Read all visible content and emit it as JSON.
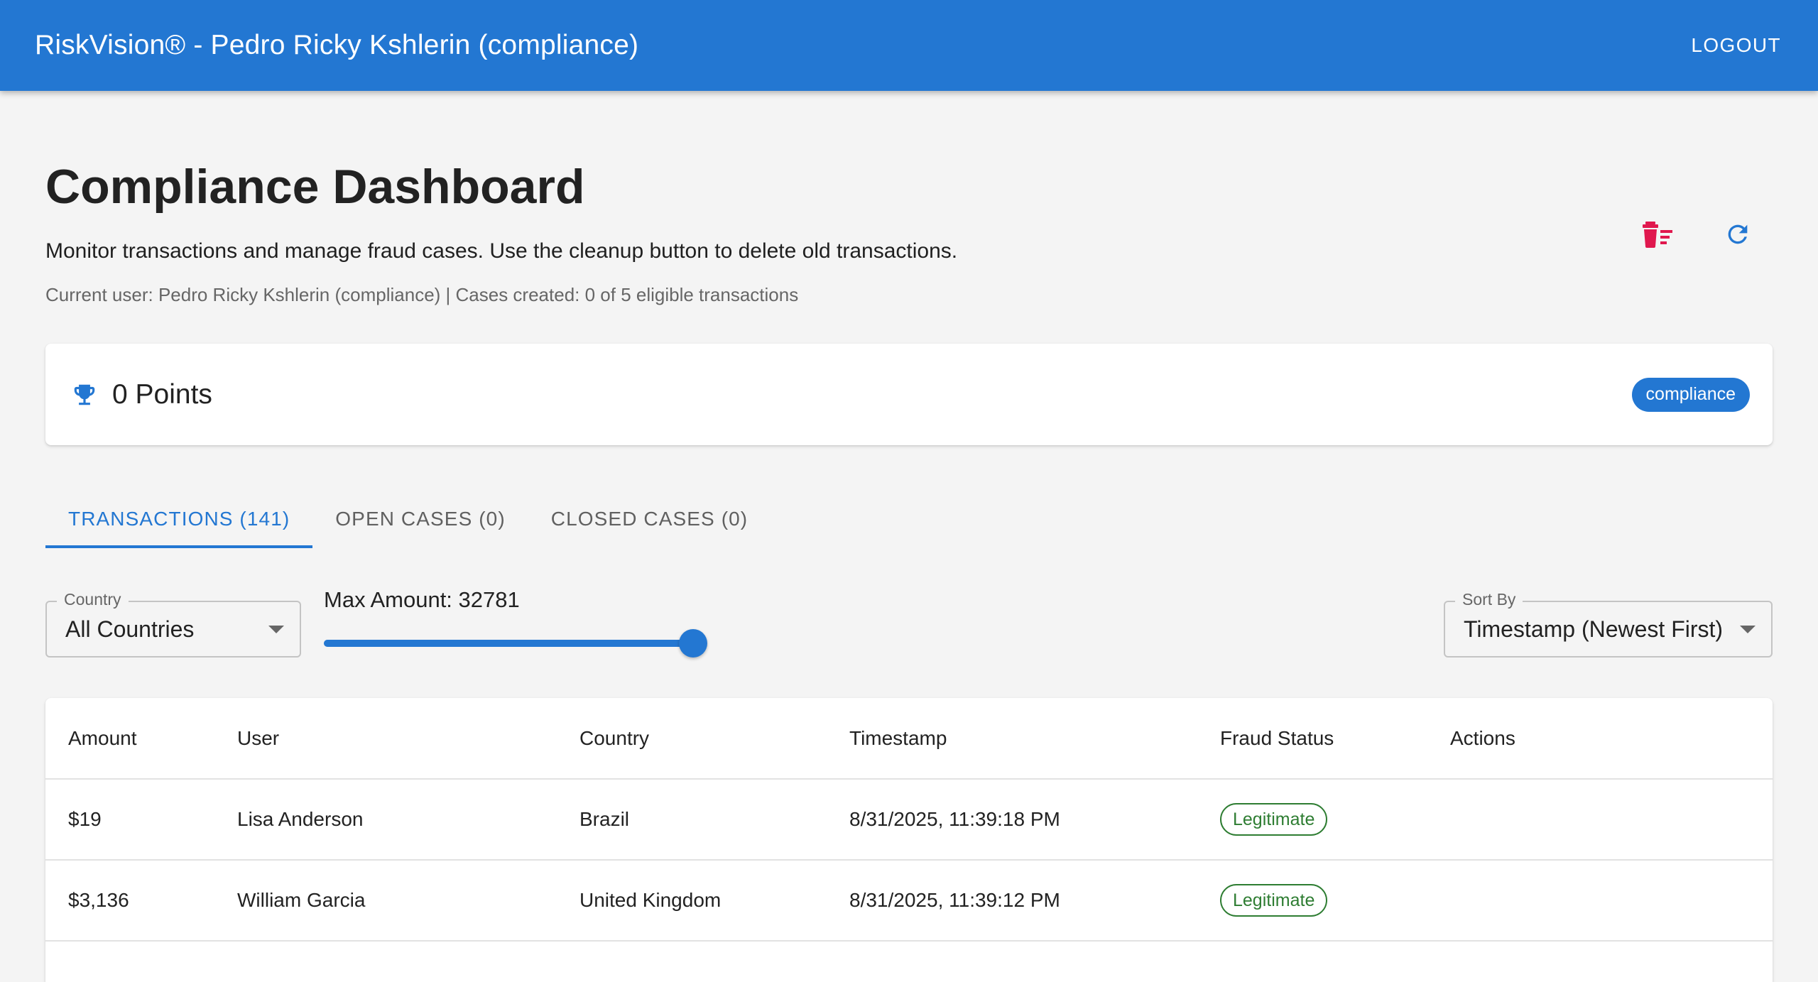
{
  "appbar": {
    "title": "RiskVision® - Pedro Ricky Kshlerin (compliance)",
    "logout_label": "LOGOUT"
  },
  "header": {
    "title": "Compliance Dashboard",
    "description": "Monitor transactions and manage fraud cases. Use the cleanup button to delete old transactions.",
    "meta": "Current user: Pedro Ricky Kshlerin (compliance) | Cases created: 0 of 5 eligible transactions",
    "actions": [
      {
        "name": "cleanup",
        "icon": "delete-sweep-icon",
        "color": "#e0184e"
      },
      {
        "name": "refresh",
        "icon": "refresh-icon",
        "color": "#2377d2"
      }
    ]
  },
  "points_card": {
    "icon": "trophy-icon",
    "points_text": "0 Points",
    "role_chip": "compliance"
  },
  "tabs": [
    {
      "label": "TRANSACTIONS (141)",
      "active": true
    },
    {
      "label": "OPEN CASES (0)",
      "active": false
    },
    {
      "label": "CLOSED CASES (0)",
      "active": false
    }
  ],
  "filters": {
    "country": {
      "legend": "Country",
      "value": "All Countries"
    },
    "max_amount": {
      "label": "Max Amount: 32781",
      "fraction": 1.0
    },
    "sort": {
      "legend": "Sort By",
      "value": "Timestamp (Newest First)"
    }
  },
  "table": {
    "columns": [
      "Amount",
      "User",
      "Country",
      "Timestamp",
      "Fraud Status",
      "Actions"
    ],
    "rows": [
      {
        "amount": "$19",
        "user": "Lisa Anderson",
        "country": "Brazil",
        "timestamp": "8/31/2025, 11:39:18 PM",
        "status": "Legitimate"
      },
      {
        "amount": "$3,136",
        "user": "William Garcia",
        "country": "United Kingdom",
        "timestamp": "8/31/2025, 11:39:12 PM",
        "status": "Legitimate"
      },
      {
        "amount": "",
        "user": "",
        "country": "",
        "timestamp": "",
        "status": ""
      }
    ]
  },
  "colors": {
    "primary": "#2377d2",
    "danger": "#e0184e",
    "success": "#2e7d32",
    "background": "#f4f4f4"
  }
}
